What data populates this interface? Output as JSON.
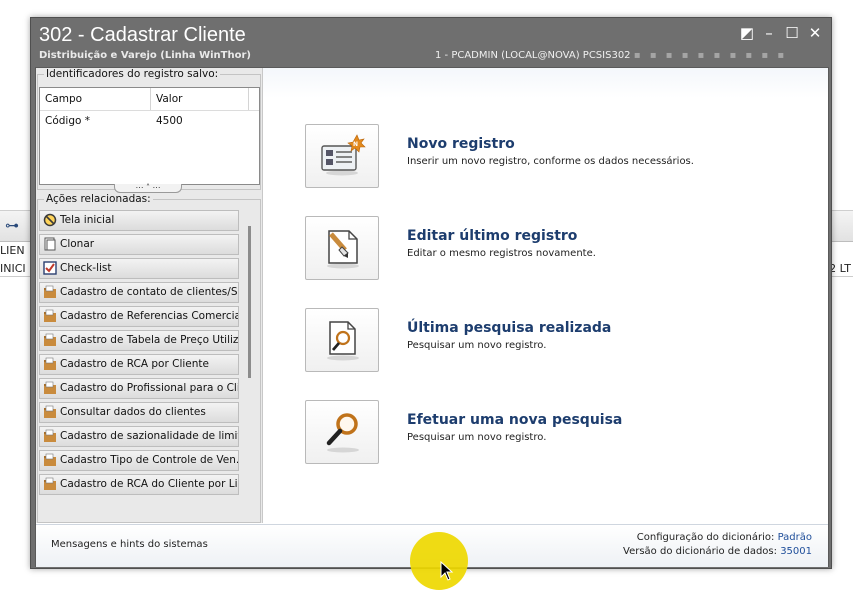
{
  "window": {
    "title": "302 - Cadastrar Cliente",
    "subtitle": "Distribuição e Varejo (Linha WinThor)",
    "session": "1 - PCADMIN (LOCAL@NOVA)   PCSIS302",
    "session_dots": "▪ ▪ ▪ ▪ ▪ ▪ ▪ ▪ ▪ ▪",
    "controls": {
      "restore": "◩",
      "minimize": "–",
      "maximize": "☐",
      "close": "✕"
    }
  },
  "background_app": {
    "row1_left": "LIEN",
    "row2_left": "INICI",
    "row2_right": "2 LT"
  },
  "identifiers": {
    "group_label": "Identificadores do registro salvo:",
    "columns": [
      "Campo",
      "Valor"
    ],
    "rows": [
      {
        "campo": "Código *",
        "valor": "4500"
      }
    ]
  },
  "splitter": {
    "label": "⋯ ˄ ⋯"
  },
  "actions": {
    "group_label": "Ações relacionadas:",
    "items": [
      {
        "label": "Tela inicial",
        "icon": "no-entry-icon"
      },
      {
        "label": "Clonar",
        "icon": "document-icon"
      },
      {
        "label": "Check-list",
        "icon": "checkbox-icon"
      },
      {
        "label": "Cadastro de contato de clientes/S...",
        "icon": "folder-icon"
      },
      {
        "label": "Cadastro de Referencias Comercia...",
        "icon": "folder-icon"
      },
      {
        "label": "Cadastro de Tabela de Preço Utiliz...",
        "icon": "folder-icon"
      },
      {
        "label": "Cadastro de RCA por Cliente",
        "icon": "folder-icon"
      },
      {
        "label": "Cadastro do Profissional para o Cli...",
        "icon": "folder-icon"
      },
      {
        "label": "Consultar dados do clientes",
        "icon": "folder-icon"
      },
      {
        "label": "Cadastro de sazionalidade de limit...",
        "icon": "folder-icon"
      },
      {
        "label": "Cadastro Tipo de Controle de Ven...",
        "icon": "folder-icon"
      },
      {
        "label": "Cadastro de RCA do Cliente por Li...",
        "icon": "folder-icon"
      }
    ]
  },
  "options": [
    {
      "title": "Novo registro",
      "desc": "Inserir um novo registro, conforme os dados necessários.",
      "icon": "new-record-icon"
    },
    {
      "title": "Editar último registro",
      "desc": "Editar o mesmo registros novamente.",
      "icon": "edit-document-icon"
    },
    {
      "title": "Última pesquisa realizada",
      "desc": "Pesquisar um novo registro.",
      "icon": "document-search-icon"
    },
    {
      "title": "Efetuar uma nova pesquisa",
      "desc": "Pesquisar um novo registro.",
      "icon": "magnifier-icon"
    }
  ],
  "status": {
    "hint": "Mensagens e hints do sistemas",
    "config_label": "Configuração do dicionário:",
    "config_value": "Padrão",
    "version_label": "Versão do dicionário de dados:",
    "version_value": "35001"
  },
  "colors": {
    "title_bar": "#6f6f6f",
    "option_title": "#1d3d6e",
    "status_value": "#1f4e9a",
    "cursor_highlight": "#eed800"
  }
}
